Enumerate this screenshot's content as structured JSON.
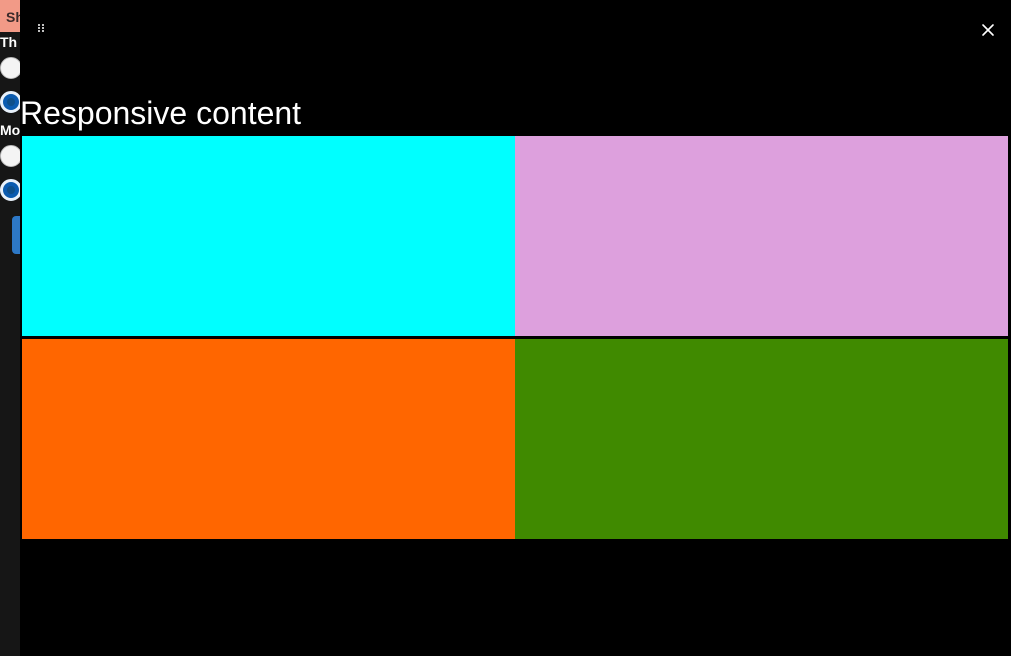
{
  "background_app": {
    "header_text": "Sh",
    "section_label_1": "Th",
    "section_label_2": "Mo",
    "colors": {
      "header": "#f29a87",
      "button": "#2d78c6",
      "radio_selected": "#0a5bb0"
    }
  },
  "sheet": {
    "title": "Responsive content",
    "drag_handle_icon": "drag-dots-icon",
    "close_icon": "close-icon",
    "tiles": [
      {
        "name": "tile-cyan",
        "color": "#00ffff"
      },
      {
        "name": "tile-plum",
        "color": "#dda0dd"
      },
      {
        "name": "tile-orange",
        "color": "#ff6600"
      },
      {
        "name": "tile-green",
        "color": "#408a00"
      }
    ]
  }
}
